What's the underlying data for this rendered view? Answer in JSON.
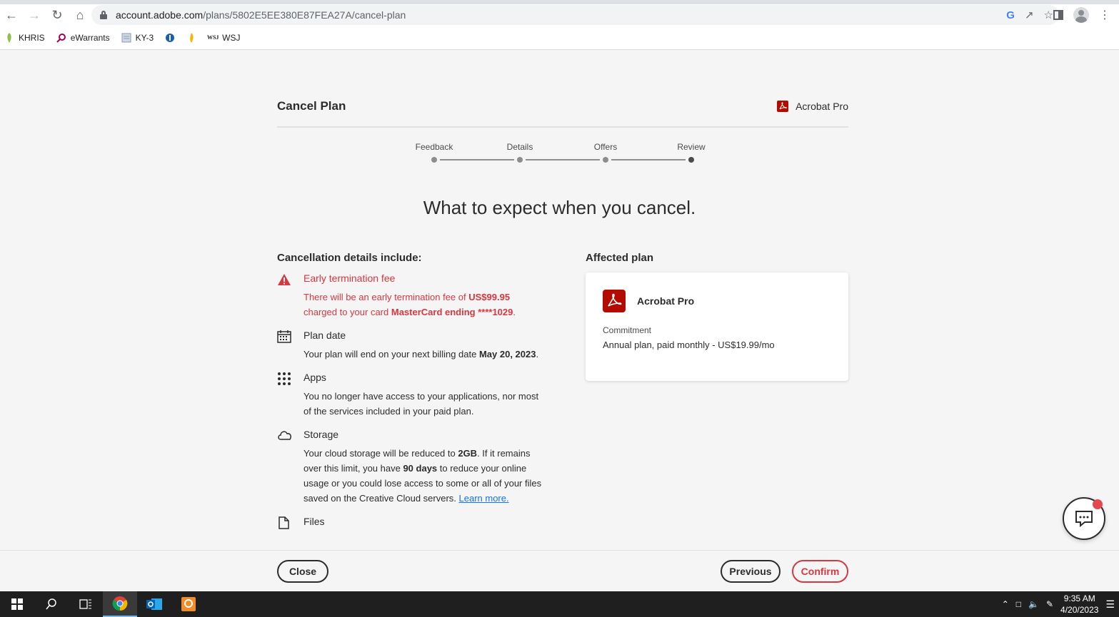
{
  "browser": {
    "url_host": "account.adobe.com",
    "url_path": "/plans/5802E5EE380E87FEA27A/cancel-plan",
    "bookmarks": [
      {
        "label": "KHRIS",
        "icon": "khris-icon"
      },
      {
        "label": "eWarrants",
        "icon": "magnifier-icon"
      },
      {
        "label": "KY-3",
        "icon": "doc-icon"
      },
      {
        "label": "",
        "icon": "globe-icon"
      },
      {
        "label": "",
        "icon": "flame-icon"
      },
      {
        "label": "WSJ",
        "icon": "wsj-icon"
      }
    ],
    "wsj_logo": "WSJ"
  },
  "header": {
    "title": "Cancel Plan",
    "product": "Acrobat Pro"
  },
  "stepper": {
    "steps": [
      "Feedback",
      "Details",
      "Offers",
      "Review"
    ],
    "active_index": 3
  },
  "headline": "What to expect when you cancel.",
  "details": {
    "title": "Cancellation details include:",
    "items": {
      "fee": {
        "title": "Early termination fee",
        "line1_prefix": "There will be an early termination fee of ",
        "fee_amount": "US$99.95",
        "line2_prefix": "charged to your card ",
        "card": "MasterCard ending ****1029",
        "line2_suffix": "."
      },
      "plan_date": {
        "title": "Plan date",
        "body_prefix": "Your plan will end on your next billing date ",
        "date": "May 20, 2023",
        "body_suffix": "."
      },
      "apps": {
        "title": "Apps",
        "body": "You no longer have access to your applications, nor most of the services included in your paid plan."
      },
      "storage": {
        "title": "Storage",
        "p1": "Your cloud storage will be reduced to ",
        "size": "2GB",
        "p2": ". If it remains over this limit, you have ",
        "days": "90 days",
        "p3": " to reduce your online usage or you could lose access to some or all of your files saved on the Creative Cloud servers. ",
        "link": "Learn more."
      },
      "files": {
        "title": "Files"
      }
    }
  },
  "affected": {
    "title": "Affected plan",
    "plan_name": "Acrobat Pro",
    "commitment_label": "Commitment",
    "commitment_value": "Annual plan, paid monthly - US$19.99/mo"
  },
  "footer": {
    "close": "Close",
    "previous": "Previous",
    "confirm": "Confirm"
  },
  "taskbar": {
    "time": "9:35 AM",
    "date": "4/20/2023"
  },
  "colors": {
    "accent_red": "#d7373f",
    "acrobat_red": "#b30b00",
    "link_blue": "#1473e6"
  }
}
